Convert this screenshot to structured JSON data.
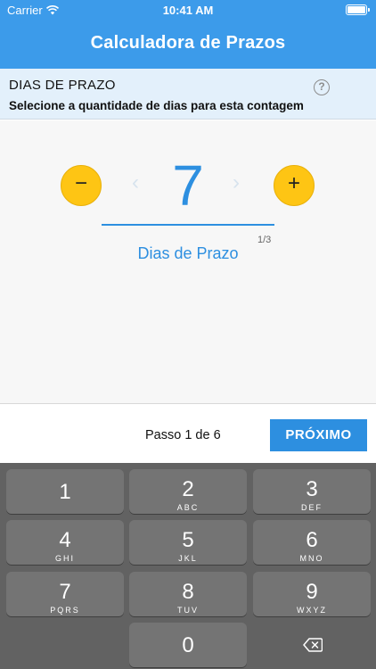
{
  "status_bar": {
    "carrier": "Carrier",
    "time": "10:41 AM"
  },
  "nav": {
    "title": "Calculadora de Prazos"
  },
  "section": {
    "title": "DIAS DE PRAZO",
    "subtitle": "Selecione a quantidade de dias para esta contagem",
    "help_icon": "question-circle-icon"
  },
  "picker": {
    "value": "7",
    "minus_symbol": "−",
    "plus_symbol": "+",
    "prev_symbol": "‹",
    "next_symbol": "›",
    "counter": "1/3",
    "label": "Dias de Prazo"
  },
  "footer": {
    "step_text": "Passo 1 de 6",
    "next_label": "PRÓXIMO"
  },
  "keyboard": {
    "keys": [
      {
        "num": "1",
        "letters": ""
      },
      {
        "num": "2",
        "letters": "ABC"
      },
      {
        "num": "3",
        "letters": "DEF"
      },
      {
        "num": "4",
        "letters": "GHI"
      },
      {
        "num": "5",
        "letters": "JKL"
      },
      {
        "num": "6",
        "letters": "MNO"
      },
      {
        "num": "7",
        "letters": "PQRS"
      },
      {
        "num": "8",
        "letters": "TUV"
      },
      {
        "num": "9",
        "letters": "WXYZ"
      },
      {
        "num": "0",
        "letters": ""
      }
    ],
    "backspace_icon": "backspace-icon"
  },
  "colors": {
    "primary": "#3c9bea",
    "accent_blue": "#2d8fe0",
    "yellow": "#fec514",
    "keyboard_bg": "#626262"
  }
}
